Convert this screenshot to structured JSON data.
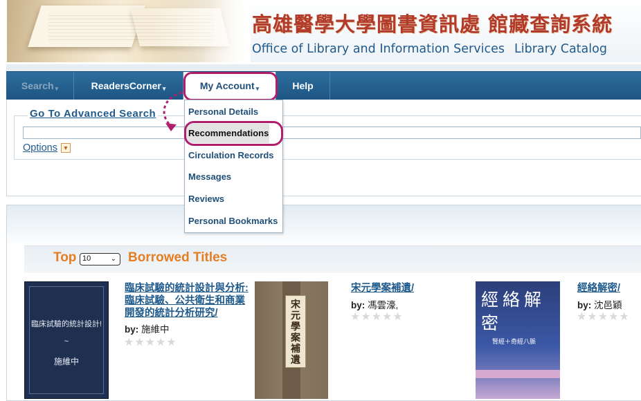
{
  "header": {
    "title_zh": "高雄醫學大學圖書資訊處 館藏查詢系統",
    "title_en_office": "Office of Library and Information Services",
    "title_en_catalog": "Library Catalog"
  },
  "nav": {
    "search": "Search",
    "readers_corner": "ReadersCorner",
    "my_account": "My Account",
    "help": "Help",
    "caret": "▾"
  },
  "account_menu": {
    "items": [
      "Personal Details",
      "Recommendations",
      "Circulation Records",
      "Messages",
      "Reviews",
      "Personal Bookmarks"
    ],
    "highlighted": "Recommendations"
  },
  "search": {
    "advanced_link": "Go To Advanced Search",
    "query": "",
    "options_label": "Options",
    "options_icon": "chevron-down-icon"
  },
  "top_borrowed": {
    "prefix": "Top",
    "suffix": "Borrowed Titles",
    "count_selected": "10",
    "books": [
      {
        "title": "臨床試驗的統計設計與分析: 臨床試驗、公共衛生和商業開發的統計分析研究/",
        "by_label": "by:",
        "author": "施維中",
        "rating": 0,
        "cover_title": "臨床試驗的統計設計!",
        "cover_tilde": "~",
        "cover_author": "施維中"
      },
      {
        "title": "宋元學案補遺/",
        "by_label": "by:",
        "author": "馮雲濠,",
        "rating": 0,
        "cover_title": "宋元學案補遺"
      },
      {
        "title": "經絡解密/",
        "by_label": "by:",
        "author": "沈邑穎",
        "rating": 0,
        "cover_title": "經絡解密",
        "cover_subtitle": "腎經＋奇經八脈"
      }
    ]
  },
  "colors": {
    "nav_bg": "#1d5583",
    "link": "#1f5a8c",
    "accent_orange": "#e57d22",
    "highlight_ring": "#b01e6e",
    "title_red": "#b23a2b"
  }
}
